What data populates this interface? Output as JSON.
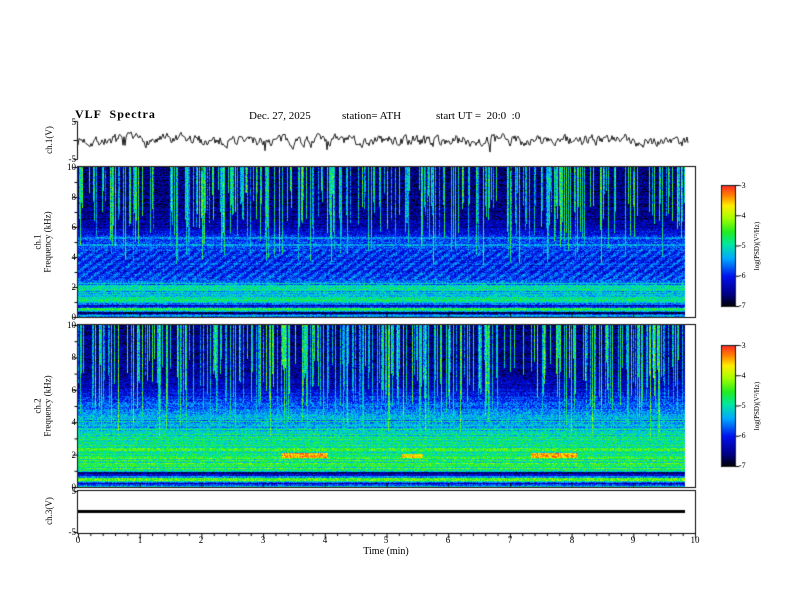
{
  "header": {
    "title": "VLF  Spectra",
    "date": "Dec. 27, 2025",
    "station": "station= ATH",
    "start_ut": "start UT =  20:0  :0"
  },
  "axes": {
    "time_label": "Time (min)",
    "time_ticks": [
      "0",
      "1",
      "2",
      "3",
      "4",
      "5",
      "6",
      "7",
      "8",
      "9",
      "10"
    ],
    "freq_ticks": [
      "10",
      "8",
      "6",
      "4",
      "2",
      "0"
    ],
    "volt_top": "5",
    "volt_bottom": "-5"
  },
  "panels": {
    "ch1_wave_label": "ch.1(V)",
    "ch1_spec_label1": "ch.1",
    "ch1_spec_label2": "Frequency (kHz)",
    "ch2_spec_label1": "ch.2",
    "ch2_spec_label2": "Frequency (kHz)",
    "ch3_wave_label": "ch.3(V)"
  },
  "colorbar": {
    "label": "log(PSD)(V²/Hz)",
    "ticks": [
      "-3",
      "-4",
      "-5",
      "-6",
      "-7"
    ],
    "colormap": [
      [
        0.0,
        "#000000"
      ],
      [
        0.1,
        "#000085"
      ],
      [
        0.25,
        "#0010ee"
      ],
      [
        0.4,
        "#00aaff"
      ],
      [
        0.52,
        "#00e8a0"
      ],
      [
        0.62,
        "#22ee22"
      ],
      [
        0.74,
        "#aaff00"
      ],
      [
        0.84,
        "#ffee00"
      ],
      [
        0.92,
        "#ff8800"
      ],
      [
        1.0,
        "#ff3322"
      ]
    ]
  },
  "chart_data": [
    {
      "panel": "ch1_waveform",
      "type": "line",
      "ylabel": "ch.1(V)",
      "ylim": [
        -5,
        5
      ],
      "xlim": [
        0,
        10
      ],
      "data_end_min": 9.9,
      "summary": "broadband noise around 0 V, ~±1 V, intermittent negative spikes to ~-3 V",
      "signal": {
        "seed": 7,
        "smooth": 0.55,
        "noise_v": 1.1,
        "spike_prob": 0.015,
        "spike_v": 2.0
      }
    },
    {
      "panel": "ch1_spectrogram",
      "type": "heatmap",
      "ylabel": "ch.1 Frequency (kHz)",
      "zlabel": "log(PSD)(V²/Hz)",
      "xlim": [
        0,
        10
      ],
      "ylim": [
        0,
        10
      ],
      "zlim": [
        -7,
        -3
      ],
      "data_end_min": 9.85,
      "summary": "dense vertical sferic streaks above ~4 kHz over dark-blue background; banded green emissions below ~2.5 kHz; bright narrow lines near 0.5, 1.3 and 2 kHz",
      "seed": 42,
      "profile": [
        [
          0,
          0.55
        ],
        [
          0.28,
          0.12
        ],
        [
          0.5,
          0.6
        ],
        [
          0.8,
          0.18
        ],
        [
          1.05,
          0.5
        ],
        [
          1.5,
          0.48
        ],
        [
          2.15,
          0.45
        ],
        [
          2.5,
          0.3
        ],
        [
          3.0,
          0.28
        ],
        [
          4.4,
          0.28
        ],
        [
          4.75,
          0.32
        ],
        [
          5.1,
          0.28
        ],
        [
          5.5,
          0.26
        ],
        [
          6.0,
          0.16
        ],
        [
          6.6,
          0.12
        ],
        [
          10,
          0.1
        ]
      ],
      "hlines": [
        {
          "f": 0.55,
          "v": 0.6
        },
        {
          "f": 1.3,
          "v": 0.52
        },
        {
          "f": 2.0,
          "v": 0.5
        },
        {
          "f": 4.85,
          "v": 0.4
        },
        {
          "f": 5.3,
          "v": 0.38
        },
        {
          "f": 0.3,
          "v": 0.06,
          "dark": true
        }
      ],
      "hband_fmax": 2.4,
      "hband_amp": 0.2,
      "dot_region": [
        2.5,
        4.5
      ],
      "dot_amp": 0.06,
      "streak_density": 0.42,
      "streak_fstop": [
        3.5,
        8.5
      ],
      "streak_strength": [
        0.35,
        0.62
      ],
      "pixel_noise": 0.2
    },
    {
      "panel": "ch2_spectrogram",
      "type": "heatmap",
      "ylabel": "ch.2 Frequency (kHz)",
      "zlabel": "log(PSD)(V²/Hz)",
      "xlim": [
        0,
        10
      ],
      "ylim": [
        0,
        10
      ],
      "zlim": [
        -7,
        -3
      ],
      "data_end_min": 9.85,
      "summary": "strong green/yellow banded emissions below ~4 kHz, vertical sferic streaks above; short red-brown patches near 2 kHz around 3.3-4.0 min and 7.4-8.1 min; dark line near 0.9 kHz",
      "seed": 77,
      "profile": [
        [
          0,
          0.6
        ],
        [
          0.22,
          0.14
        ],
        [
          0.45,
          0.62
        ],
        [
          0.75,
          0.22
        ],
        [
          1.0,
          0.56
        ],
        [
          2.3,
          0.56
        ],
        [
          3.2,
          0.5
        ],
        [
          4.2,
          0.42
        ],
        [
          5.2,
          0.3
        ],
        [
          6.2,
          0.17
        ],
        [
          7.0,
          0.13
        ],
        [
          10,
          0.1
        ]
      ],
      "hlines": [
        {
          "f": 0.5,
          "v": 0.66
        },
        {
          "f": 1.35,
          "v": 0.6
        },
        {
          "f": 1.8,
          "v": 0.58
        },
        {
          "f": 2.25,
          "v": 0.55
        },
        {
          "f": 2.9,
          "v": 0.5
        },
        {
          "f": 4.6,
          "v": 0.34
        },
        {
          "f": 0.9,
          "v": 0.1,
          "dark": true
        }
      ],
      "hband_fmax": 4.2,
      "hband_amp": 0.2,
      "dot_amp": 0,
      "segments": [
        {
          "t": [
            3.3,
            4.05
          ],
          "f": [
            1.85,
            2.1
          ],
          "v": 0.92
        },
        {
          "t": [
            7.35,
            8.1
          ],
          "f": [
            1.85,
            2.1
          ],
          "v": 0.92
        },
        {
          "t": [
            5.25,
            5.6
          ],
          "f": [
            1.85,
            2.05
          ],
          "v": 0.85
        }
      ],
      "streak_density": 0.45,
      "streak_fstop": [
        3.0,
        8.0
      ],
      "streak_strength": [
        0.35,
        0.65
      ],
      "pixel_noise": 0.2
    },
    {
      "panel": "ch3_waveform",
      "type": "line",
      "ylabel": "ch.3(V)",
      "ylim": [
        -5,
        5
      ],
      "xlim": [
        0,
        10
      ],
      "data_end_min": 9.85,
      "summary": "constant 0 V (flat thick black line)",
      "signal": {
        "constant": 0
      }
    }
  ]
}
